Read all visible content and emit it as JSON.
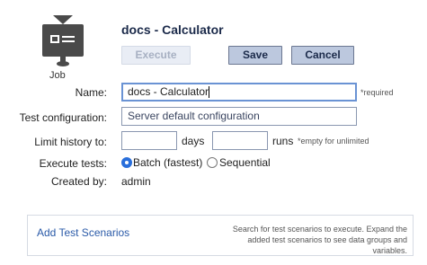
{
  "header": {
    "icon_name": "job-icon",
    "job_label": "Job",
    "title": "docs - Calculator"
  },
  "toolbar": {
    "execute_label": "Execute",
    "save_label": "Save",
    "cancel_label": "Cancel"
  },
  "form": {
    "name": {
      "label": "Name:",
      "value": "docs - Calculator",
      "hint": "*required"
    },
    "test_configuration": {
      "label": "Test configuration:",
      "value": "Server default configuration"
    },
    "limit_history": {
      "label": "Limit history to:",
      "days_value": "",
      "days_unit": "days",
      "runs_value": "",
      "runs_unit": "runs",
      "hint": "*empty for unlimited"
    },
    "execute_tests": {
      "label": "Execute tests:",
      "options": [
        {
          "label": "Batch (fastest)",
          "selected": true
        },
        {
          "label": "Sequential",
          "selected": false
        }
      ]
    },
    "created_by": {
      "label": "Created by:",
      "value": "admin"
    }
  },
  "scenarios": {
    "link_label": "Add Test Scenarios",
    "description": "Search for test scenarios to execute. Expand the added test scenarios to see data groups and variables."
  },
  "colors": {
    "primary_button_bg": "#bcc8de",
    "title_color": "#1b2a4a",
    "link_color": "#2a5aa8",
    "radio_selected": "#2a6fdb"
  }
}
